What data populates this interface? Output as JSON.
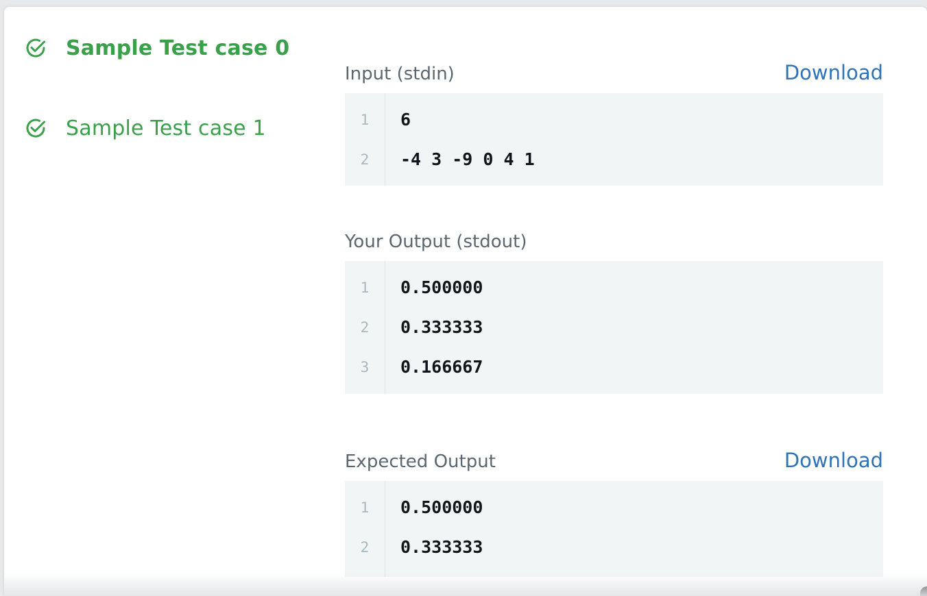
{
  "sidebar": {
    "test_cases": [
      {
        "label": "Sample Test case 0",
        "status": "passed",
        "active": true
      },
      {
        "label": "Sample Test case 1",
        "status": "passed",
        "active": false
      }
    ]
  },
  "input": {
    "title": "Input (stdin)",
    "download_label": "Download",
    "line_numbers": [
      "1",
      "2"
    ],
    "lines": [
      "6",
      "-4 3 -9 0 4 1"
    ]
  },
  "your_output": {
    "title": "Your Output (stdout)",
    "line_numbers": [
      "1",
      "2",
      "3"
    ],
    "lines": [
      "0.500000",
      "0.333333",
      "0.166667"
    ]
  },
  "expected_output": {
    "title": "Expected Output",
    "download_label": "Download",
    "line_numbers": [
      "1",
      "2"
    ],
    "lines": [
      "0.500000",
      "0.333333"
    ]
  },
  "colors": {
    "success": "#3aa14a",
    "link": "#2e73b8",
    "code_bg": "#f2f5f6",
    "muted_text": "#5b6770"
  },
  "icons": {
    "test_case_status": "check-circle-icon"
  }
}
